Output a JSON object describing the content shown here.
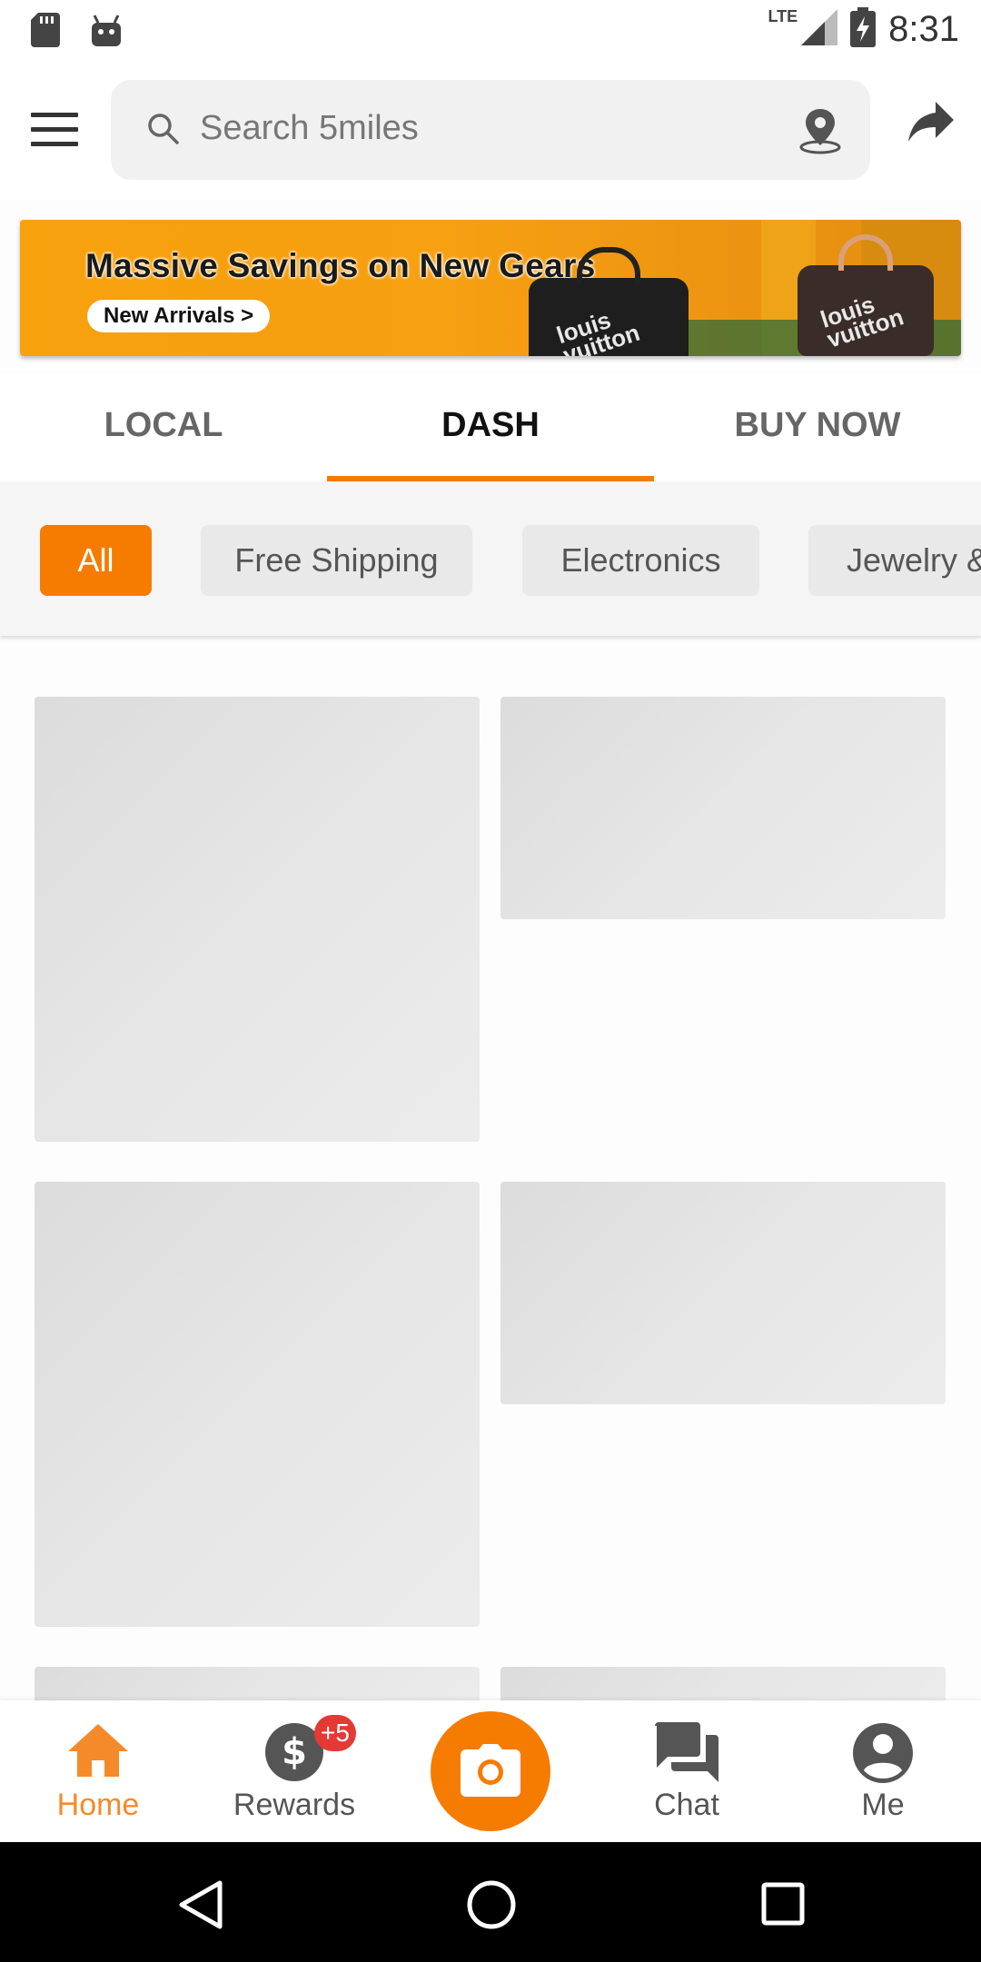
{
  "status_bar": {
    "time": "8:31",
    "network": "LTE",
    "icons": [
      "sd-card-icon",
      "android-icon",
      "signal-icon",
      "battery-charging-icon"
    ]
  },
  "app_bar": {
    "search_placeholder": "Search 5miles",
    "icons": [
      "menu-icon",
      "search-icon",
      "location-pin-icon",
      "share-icon"
    ]
  },
  "banner": {
    "headline": "Massive Savings on New Gears",
    "cta": "New Arrivals >",
    "bag_text": "louis vuitton"
  },
  "tabs": [
    {
      "label": "LOCAL",
      "active": false
    },
    {
      "label": "DASH",
      "active": true
    },
    {
      "label": "BUY NOW",
      "active": false
    }
  ],
  "chips": [
    {
      "label": "All",
      "active": true
    },
    {
      "label": "Free Shipping",
      "active": false
    },
    {
      "label": "Electronics",
      "active": false
    },
    {
      "label": "Jewelry &",
      "active": false
    }
  ],
  "bottom_nav": {
    "items": [
      {
        "label": "Home",
        "icon": "home-icon",
        "active": true
      },
      {
        "label": "Rewards",
        "icon": "dollar-icon",
        "badge": "+5"
      },
      {
        "label": "",
        "icon": "camera-icon"
      },
      {
        "label": "Chat",
        "icon": "chat-icon"
      },
      {
        "label": "Me",
        "icon": "account-icon"
      }
    ]
  },
  "colors": {
    "accent": "#f57c00",
    "badge": "#e53935",
    "placeholder": "#e2e2e2"
  }
}
